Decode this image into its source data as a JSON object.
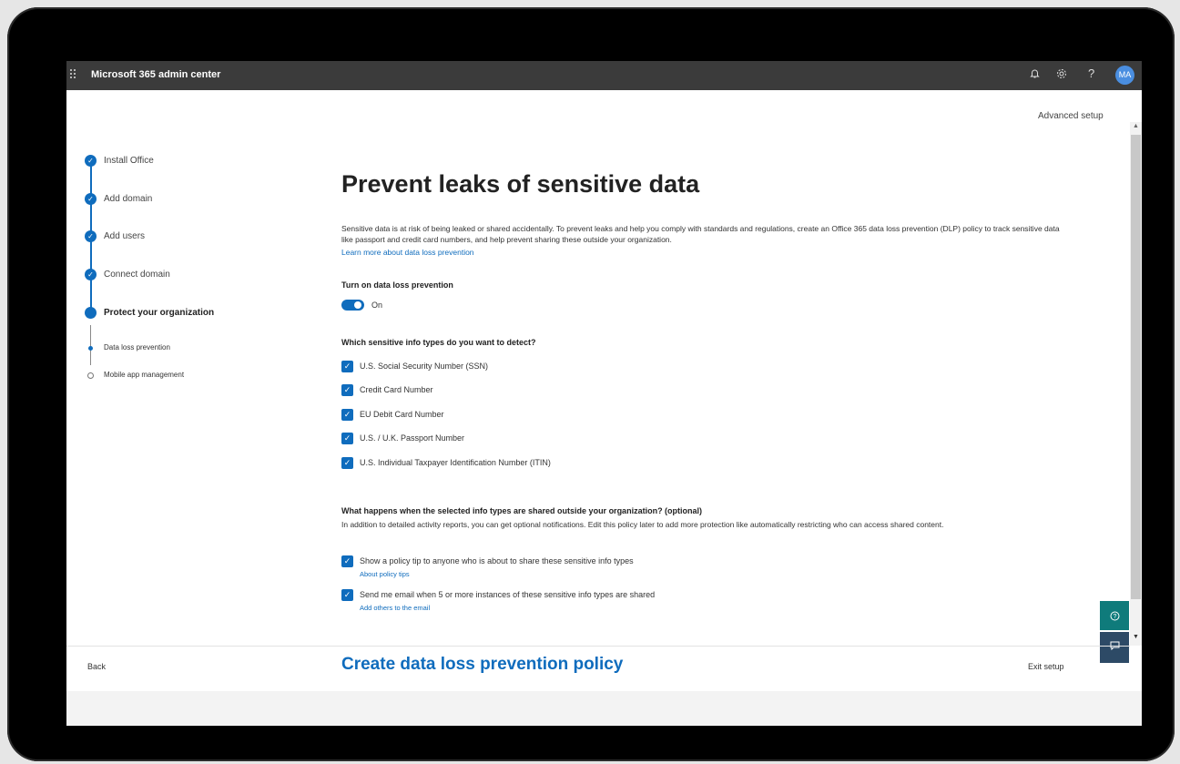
{
  "topbar": {
    "app_title": "Microsoft 365 admin center",
    "icons": [
      "bell-icon",
      "gear-icon",
      "help-icon"
    ],
    "help_glyph": "?",
    "avatar_initials": "MA"
  },
  "advanced_setup": "Advanced setup",
  "steps": [
    {
      "label": "Install Office",
      "state": "complete"
    },
    {
      "label": "Add domain",
      "state": "complete"
    },
    {
      "label": "Add users",
      "state": "complete"
    },
    {
      "label": "Connect domain",
      "state": "complete"
    },
    {
      "label": "Protect your organization",
      "state": "current"
    }
  ],
  "substeps": [
    {
      "label": "Data loss prevention",
      "state": "current"
    },
    {
      "label": "Mobile app management",
      "state": "pending"
    }
  ],
  "main": {
    "title": "Prevent leaks of sensitive data",
    "description": "Sensitive data is at risk of being leaked or shared accidentally. To prevent leaks and help you comply with standards and regulations, create an Office 365 data loss prevention (DLP) policy to track sensitive data like passport and credit card numbers, and help prevent sharing these outside your organization.",
    "learn_more": "Learn more about data loss prevention",
    "toggle_heading": "Turn on data loss prevention",
    "toggle_label": "On",
    "types_heading": "Which sensitive info types do you want to detect?",
    "info_types": [
      "U.S. Social Security Number (SSN)",
      "Credit Card Number",
      "EU Debit Card Number",
      "U.S. / U.K. Passport Number",
      "U.S. Individual Taxpayer Identification Number (ITIN)"
    ],
    "share_heading": "What happens when the selected info types are shared outside your organization? (optional)",
    "share_description": "In addition to detailed activity reports, you can get optional notifications. Edit this policy later to add more protection like automatically restricting who can access shared content.",
    "options": [
      {
        "label": "Show a policy tip to anyone who is about to share these sensitive info types",
        "link": "About policy tips"
      },
      {
        "label": "Send me email when 5 or more instances of these sensitive info types are shared",
        "link": "Add others to the email"
      }
    ]
  },
  "footer": {
    "back": "Back",
    "cta": "Create data loss prevention policy",
    "exit": "Exit setup"
  },
  "colors": {
    "accent": "#0f6cbd",
    "topbar": "#3b3b3b",
    "help_button": "#0f7b7b",
    "feedback_button": "#2d4a66"
  }
}
